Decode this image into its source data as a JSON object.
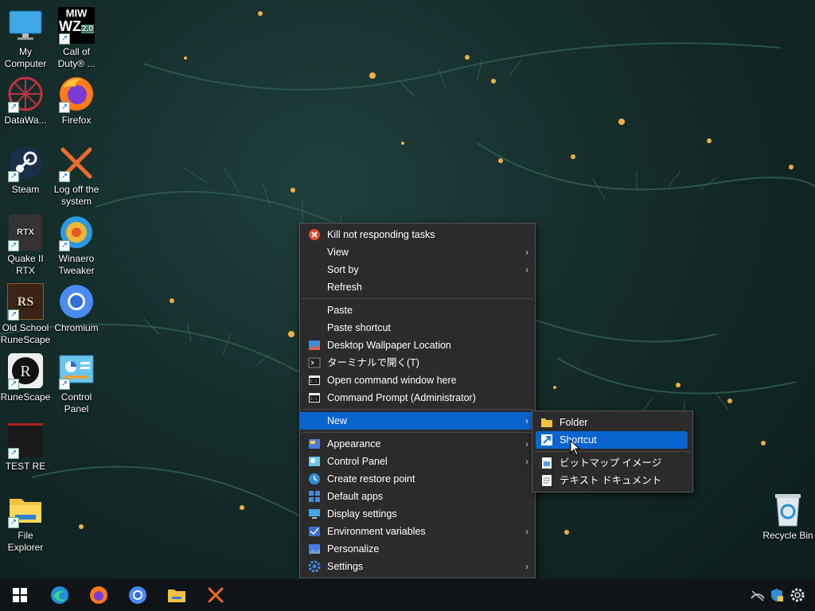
{
  "desktop_icons": [
    {
      "label": "My Computer"
    },
    {
      "label": "Call of Duty® ..."
    },
    {
      "label": "DataWa..."
    },
    {
      "label": "Firefox"
    },
    {
      "label": "Steam"
    },
    {
      "label": "Log off the system"
    },
    {
      "label": "Quake II RTX"
    },
    {
      "label": "Winaero Tweaker"
    },
    {
      "label": "Old School RuneScape"
    },
    {
      "label": "Chromium"
    },
    {
      "label": "RuneScape"
    },
    {
      "label": "Control Panel"
    },
    {
      "label": "TEST RE"
    },
    {
      "label": "File Explorer"
    },
    {
      "label": "Recycle Bin"
    }
  ],
  "icon_text": {
    "mw_line1": "MIW",
    "mw_line2": "WZ",
    "mw_ver": "2.0",
    "rtx": "RTX"
  },
  "context_menu": {
    "items": [
      {
        "label": "Kill not responding tasks"
      },
      {
        "label": "View"
      },
      {
        "label": "Sort by"
      },
      {
        "label": "Refresh"
      },
      {
        "label": "Paste"
      },
      {
        "label": "Paste shortcut"
      },
      {
        "label": "Desktop Wallpaper Location"
      },
      {
        "label": "ターミナルで開く(T)"
      },
      {
        "label": "Open command window here"
      },
      {
        "label": "Command Prompt (Administrator)"
      },
      {
        "label": "New"
      },
      {
        "label": "Appearance"
      },
      {
        "label": "Control Panel"
      },
      {
        "label": "Create restore point"
      },
      {
        "label": "Default apps"
      },
      {
        "label": "Display settings"
      },
      {
        "label": "Environment variables"
      },
      {
        "label": "Personalize"
      },
      {
        "label": "Settings"
      }
    ]
  },
  "submenu_new": {
    "items": [
      {
        "label": "Folder"
      },
      {
        "label": "Shortcut"
      },
      {
        "label": "ビットマップ イメージ"
      },
      {
        "label": "テキスト ドキュメント"
      }
    ]
  },
  "colors": {
    "highlight": "#0a64d0",
    "menu_bg": "#2b2b2b"
  },
  "taskbar": {
    "icons": [
      "windows-start-icon",
      "edge-icon",
      "firefox-icon",
      "chromium-icon",
      "file-explorer-icon",
      "log-off-icon"
    ],
    "tray": [
      "network-disconnected-icon",
      "security-icon",
      "settings-gear-icon"
    ]
  }
}
